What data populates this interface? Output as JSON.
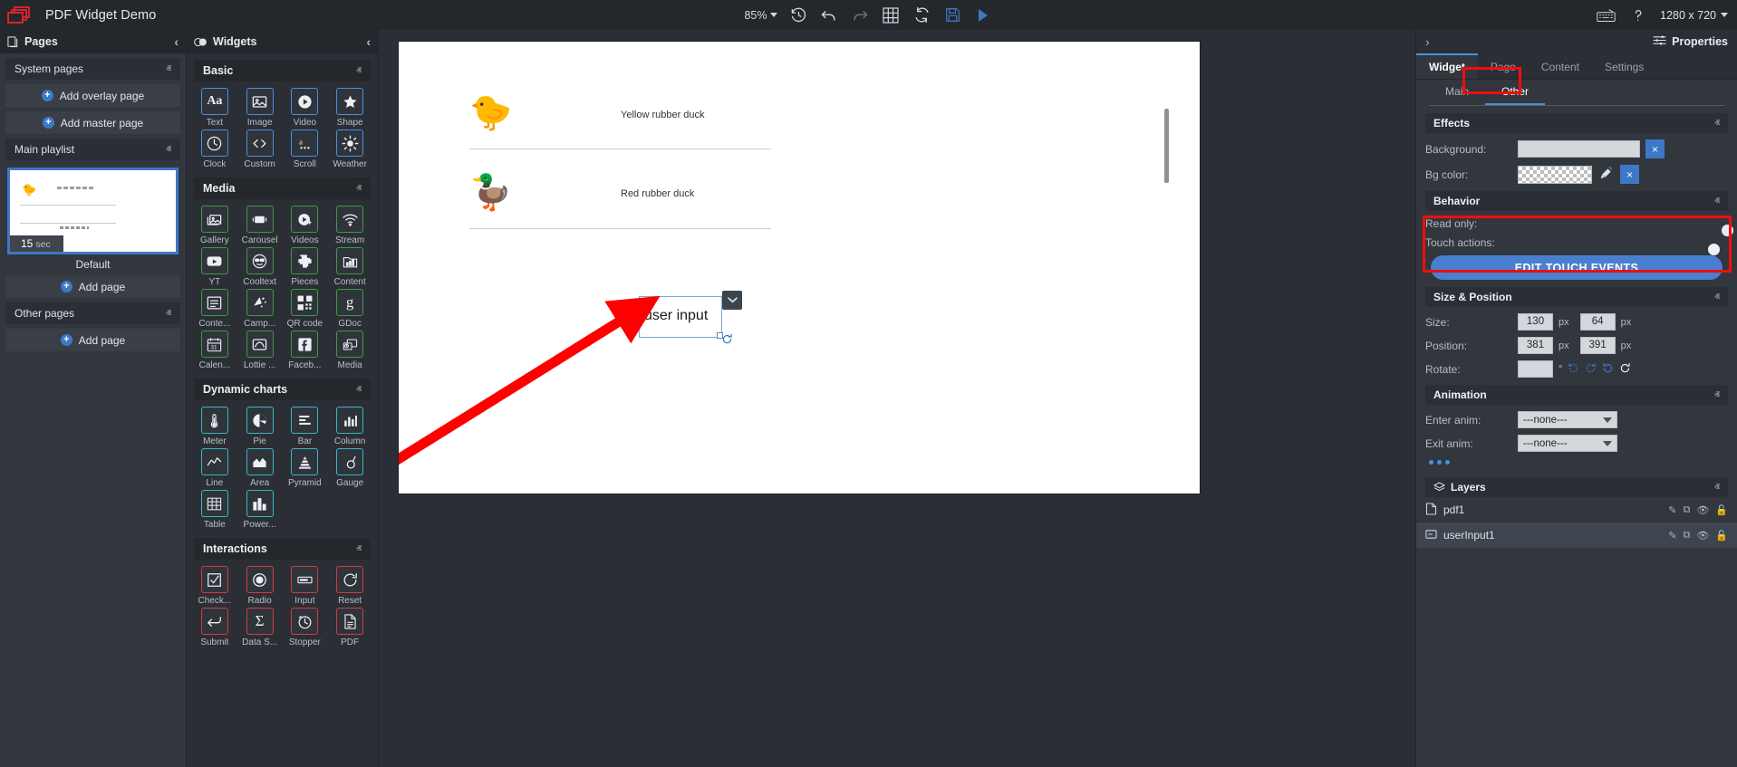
{
  "topbar": {
    "logo": "app-logo",
    "title": "PDF Widget Demo",
    "zoom": "85%",
    "resolution": "1280 x 720",
    "icons": [
      {
        "name": "history-icon",
        "label": "History"
      },
      {
        "name": "undo-icon",
        "label": "Undo"
      },
      {
        "name": "redo-icon",
        "label": "Redo"
      },
      {
        "name": "grid-icon",
        "label": "Grid"
      },
      {
        "name": "refresh-icon",
        "label": "Refresh"
      },
      {
        "name": "save-icon",
        "label": "Save"
      },
      {
        "name": "play-icon",
        "label": "Preview"
      }
    ],
    "keyboard_icon": "keyboard-icon",
    "help_icon": "help-icon"
  },
  "pages_panel": {
    "title": "Pages",
    "collapse": "‹",
    "sections": [
      {
        "label": "System pages",
        "chev": "ⱏ"
      },
      {
        "label": "Main playlist",
        "chev": "ⱏ"
      },
      {
        "label": "Other pages",
        "chev": "ⱏ"
      }
    ],
    "buttons": {
      "add_overlay": "Add overlay page",
      "add_master": "Add master page",
      "add_page": "Add page",
      "add_page_other": "Add page"
    },
    "thumbnail": {
      "duration_value": "15",
      "duration_unit": "sec",
      "name": "Default",
      "preview_text_1": "Yellow rubber duck",
      "preview_text_2": "user input"
    }
  },
  "widgets_panel": {
    "title": "Widgets",
    "collapse": "‹",
    "categories": [
      {
        "name": "Basic",
        "chev": "ⱏ",
        "color": "#4a8fe0",
        "items": [
          {
            "label": "Text",
            "icon": "text-aa-icon"
          },
          {
            "label": "Image",
            "icon": "image-icon"
          },
          {
            "label": "Video",
            "icon": "video-play-icon"
          },
          {
            "label": "Shape",
            "icon": "star-shape-icon"
          },
          {
            "label": "Clock",
            "icon": "clock-icon"
          },
          {
            "label": "Custom",
            "icon": "code-icon"
          },
          {
            "label": "Scroll",
            "icon": "scroll-text-icon"
          },
          {
            "label": "Weather",
            "icon": "weather-sun-icon"
          }
        ]
      },
      {
        "name": "Media",
        "chev": "ⱏ",
        "color": "#3f9a42",
        "items": [
          {
            "label": "Gallery",
            "icon": "gallery-icon"
          },
          {
            "label": "Carousel",
            "icon": "carousel-icon"
          },
          {
            "label": "Videos",
            "icon": "videos-icon"
          },
          {
            "label": "Stream",
            "icon": "stream-wifi-icon"
          },
          {
            "label": "YT",
            "icon": "youtube-icon"
          },
          {
            "label": "Cooltext",
            "icon": "cooltext-face-icon"
          },
          {
            "label": "Pieces",
            "icon": "puzzle-piece-icon"
          },
          {
            "label": "Content",
            "icon": "content-chart-icon"
          },
          {
            "label": "Conte...",
            "icon": "content-list-icon"
          },
          {
            "label": "Camp...",
            "icon": "campaign-icon"
          },
          {
            "label": "QR code",
            "icon": "qrcode-icon"
          },
          {
            "label": "GDoc",
            "icon": "google-doc-icon"
          },
          {
            "label": "Calen...",
            "icon": "calendar-31-icon"
          },
          {
            "label": "Lottie ...",
            "icon": "lottie-icon"
          },
          {
            "label": "Faceb...",
            "icon": "facebook-icon"
          },
          {
            "label": "Media",
            "icon": "media-icon"
          }
        ]
      },
      {
        "name": "Dynamic charts",
        "chev": "ⱏ",
        "color": "#39b5c4",
        "items": [
          {
            "label": "Meter",
            "icon": "meter-thermometer-icon"
          },
          {
            "label": "Pie",
            "icon": "pie-chart-icon"
          },
          {
            "label": "Bar",
            "icon": "bar-chart-icon"
          },
          {
            "label": "Column",
            "icon": "column-chart-icon"
          },
          {
            "label": "Line",
            "icon": "line-chart-icon"
          },
          {
            "label": "Area",
            "icon": "area-chart-icon"
          },
          {
            "label": "Pyramid",
            "icon": "pyramid-chart-icon"
          },
          {
            "label": "Gauge",
            "icon": "gauge-icon"
          },
          {
            "label": "Table",
            "icon": "table-icon"
          },
          {
            "label": "Power...",
            "icon": "powerbi-icon"
          }
        ]
      },
      {
        "name": "Interactions",
        "chev": "ⱏ",
        "color": "#cf3b44",
        "items": [
          {
            "label": "Check...",
            "icon": "checkbox-icon"
          },
          {
            "label": "Radio",
            "icon": "radio-button-icon"
          },
          {
            "label": "Input",
            "icon": "text-input-icon"
          },
          {
            "label": "Reset",
            "icon": "reset-icon"
          },
          {
            "label": "Submit",
            "icon": "submit-arrow-icon"
          },
          {
            "label": "Data S...",
            "icon": "sigma-data-icon"
          },
          {
            "label": "Stopper",
            "icon": "stopwatch-icon"
          },
          {
            "label": "PDF",
            "icon": "pdf-document-icon"
          }
        ]
      }
    ]
  },
  "canvas": {
    "rows": [
      {
        "duck": "🐤",
        "label": "Yellow rubber duck"
      },
      {
        "duck": "🦆",
        "label": "Red rubber duck"
      }
    ],
    "selected_widget": {
      "text": "user input",
      "dropdown_icon": "chevron-down-icon",
      "rotate_icon": "rotate-handle-icon",
      "resize_handle": "resize-handle"
    },
    "annotation": {
      "icon": "red-arrow-annotation"
    }
  },
  "properties": {
    "title": "Properties",
    "expand_icon": "›",
    "settings_icon": "sliders-icon",
    "tabs": [
      {
        "label": "Widget",
        "active": true
      },
      {
        "label": "Page",
        "active": false
      },
      {
        "label": "Content",
        "active": false
      },
      {
        "label": "Settings",
        "active": false
      }
    ],
    "subtabs": [
      {
        "label": "Main",
        "active": false
      },
      {
        "label": "Other",
        "active": true
      }
    ],
    "effects": {
      "title": "Effects",
      "chev": "ⱏ",
      "background_label": "Background:",
      "background_clear": "×",
      "bgcolor_label": "Bg color:",
      "bgcolor_picker_icon": "eyedropper-icon",
      "bgcolor_clear": "×"
    },
    "behavior": {
      "title": "Behavior",
      "chev": "ⱏ",
      "readonly_label": "Read only:",
      "readonly_state": "off",
      "touch_label": "Touch actions:",
      "touch_state": "on",
      "edit_touch_button": "EDIT TOUCH EVENTS"
    },
    "size_position": {
      "title": "Size & Position",
      "chev": "ⱏ",
      "size_label": "Size:",
      "size_w": "130",
      "size_h": "64",
      "position_label": "Position:",
      "pos_x": "381",
      "pos_y": "391",
      "rotate_label": "Rotate:",
      "rotate_value": "",
      "unit": "px",
      "degree": "°",
      "rotate_icons": [
        "rotate-ccw-90-icon",
        "rotate-cw-90-icon",
        "rotate-ccw-icon",
        "rotate-cw-icon"
      ]
    },
    "animation": {
      "title": "Animation",
      "chev": "ⱏ",
      "enter_label": "Enter anim:",
      "enter_value": "---none---",
      "exit_label": "Exit anim:",
      "exit_value": "---none---",
      "more_dots": "more-options-dots"
    },
    "layers": {
      "title": "Layers",
      "icon": "layers-icon",
      "chev": "ⱏ",
      "rows": [
        {
          "name": "pdf1",
          "type_icon": "document-layer-icon",
          "selected": false,
          "actions": [
            "pen-icon",
            "duplicate-icon",
            "eye-icon",
            "lock-icon"
          ]
        },
        {
          "name": "userInput1",
          "type_icon": "input-layer-icon",
          "selected": true,
          "actions": [
            "pen-icon",
            "duplicate-icon",
            "eye-icon",
            "lock-icon"
          ]
        }
      ]
    }
  }
}
